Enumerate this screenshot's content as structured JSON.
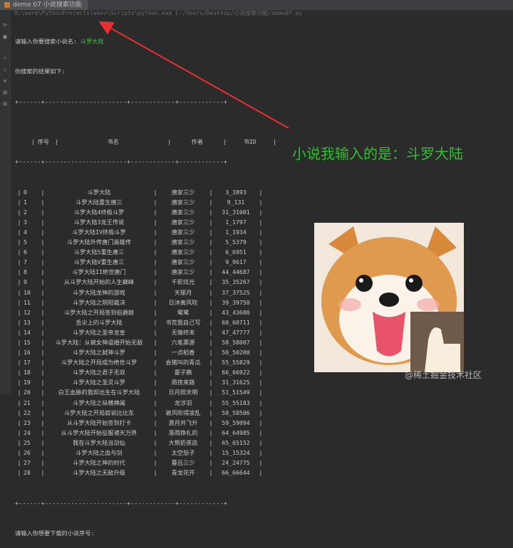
{
  "window": {
    "tab_title": "demo 07 小说搜索功能",
    "path_text": "D:\\work\\PythonProjects\\venv\\Scripts\\python.exe C:/Users/Desktop/小说搜索功能/demo07.py"
  },
  "console": {
    "prompt_search": "请输入你要搜索小说名:",
    "user_input": "斗罗大陆",
    "results_header": "你搜索的结果如下:",
    "divider_text": "+------+----------------------+------------+------------+",
    "columns": [
      "序号",
      "书名",
      "作者",
      "书ID"
    ],
    "rows": [
      [
        "0",
        "斗罗大陆",
        "唐家三少",
        "3_3893"
      ],
      [
        "1",
        "斗罗大陆重生唐三",
        "唐家三少",
        "9_131"
      ],
      [
        "2",
        "斗罗大陆4终极斗罗",
        "唐家三少",
        "31_31001"
      ],
      [
        "3",
        "斗罗大陆3龙王传说",
        "唐家三少",
        "1_1797"
      ],
      [
        "4",
        "斗罗大陆IV终极斗罗",
        "唐家三少",
        "1_1934"
      ],
      [
        "5",
        "斗罗大陆外传唐门英雄传",
        "唐家三少",
        "5_5379"
      ],
      [
        "6",
        "斗罗大陆5重生唐三",
        "唐家三少",
        "6_6951"
      ],
      [
        "7",
        "斗罗大陆V重生唐三",
        "唐家三少",
        "9_9617"
      ],
      [
        "8",
        "斗罗大陆II绝世唐门",
        "唐家三少",
        "44_44687"
      ],
      [
        "9",
        "从斗罗大陆开始的人生巅峰",
        "千影炫光",
        "35_35267"
      ],
      [
        "10",
        "斗罗大陆龙神的游戏",
        "天琊月",
        "37_37525"
      ],
      [
        "11",
        "斗罗大陆之阴阳裁决",
        "日沐离风吹",
        "39_39750"
      ],
      [
        "12",
        "斗罗大陆之开局签到伯爵娘",
        "鹭鹭",
        "43_43680"
      ],
      [
        "13",
        "舌尖上的斗罗大陆",
        "书荒我自己写",
        "60_60711"
      ],
      [
        "14",
        "斗罗大陆之圣帝龙皇",
        "无情终末",
        "47_47777"
      ],
      [
        "15",
        "斗罗大陆：从被女神逼婚开始无敌",
        "六笔票源",
        "58_58007"
      ],
      [
        "16",
        "斗罗大陆之弑神斗罗",
        "一点稻香",
        "50_50200"
      ],
      [
        "17",
        "斗罗大陆之开局成为绝世斗罗",
        "会猪叫的青瓜",
        "55_55829"
      ],
      [
        "18",
        "斗罗大陆之君子无双",
        "霍子鹏",
        "66_66922"
      ],
      [
        "19",
        "斗罗大陆之圣灵斗罗",
        "雨夜来路",
        "31_31625"
      ],
      [
        "20",
        "白王血脉的我却出生在斗罗大陆",
        "日月照天明",
        "51_51549"
      ],
      [
        "21",
        "斗罗大陆之纵横捭阖",
        "龙涉羽",
        "55_55183"
      ],
      [
        "22",
        "斗罗大陆之开局叙说比比东",
        "被风吹得凌乱",
        "58_58506"
      ],
      [
        "23",
        "从斗罗大陆开始签到打卡",
        "邀月共飞升",
        "59_59094"
      ],
      [
        "24",
        "从斗罗大陆开始征服诸天万界",
        "落雨挣扎的",
        "64_64985"
      ],
      [
        "25",
        "我在斗罗大陆当剑仙",
        "大熊奶茶店",
        "65_65152"
      ],
      [
        "26",
        "斗罗大陆之血与剑",
        "太空茄子",
        "15_15324"
      ],
      [
        "27",
        "斗罗大陆之神的时代",
        "暮吕三少",
        "24_24775"
      ],
      [
        "28",
        "斗罗大陆之无敌升级",
        "青龙花开",
        "66_66644"
      ]
    ],
    "prompt_download": "请输入你想要下载的小说序号:"
  },
  "annotation": {
    "text": "小说我输入的是：斗罗大陆",
    "color": "#2fbf2f",
    "arrow_color": "#e83030"
  },
  "watermark": "@稀土掘金技术社区",
  "icons": [
    "python-file-icon",
    "rerun-icon",
    "stop-icon",
    "up-icon",
    "down-icon",
    "wrap-icon",
    "print-icon",
    "trash-icon"
  ]
}
